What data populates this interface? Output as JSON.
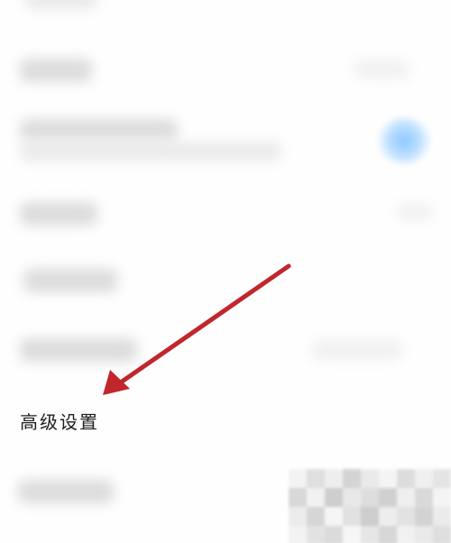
{
  "settings": {
    "advanced_label": "高级设置"
  },
  "colors": {
    "background": "#ffffff",
    "arrow": "#c0272d",
    "toggle_on": "#8ec9ff",
    "text": "#1e1e1e"
  },
  "icons": {
    "annotation": "arrow-pointer-icon",
    "toggle": "toggle-switch-icon"
  }
}
